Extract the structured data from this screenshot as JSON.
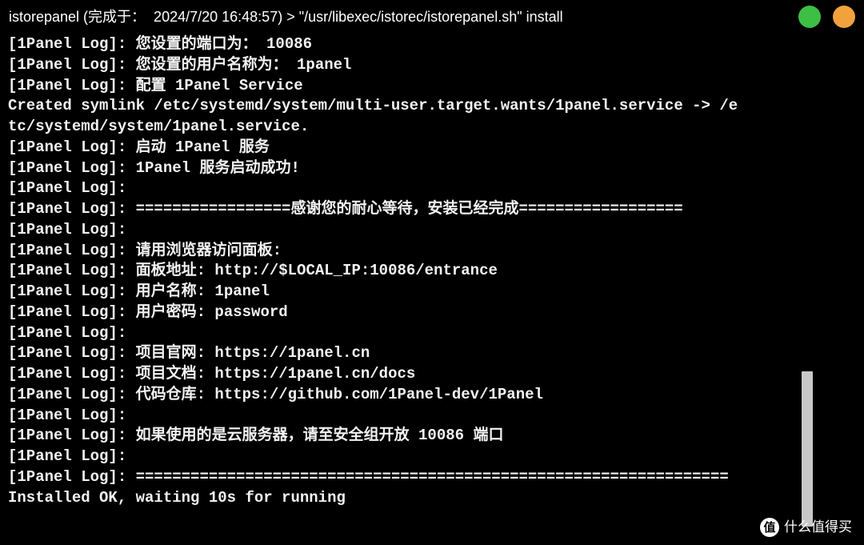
{
  "window": {
    "title": "istorepanel (完成于：  2024/7/20 16:48:57) > \"/usr/libexec/istorec/istorepanel.sh\" install",
    "buttons": {
      "green": "#3dbf45",
      "orange": "#f2a23c"
    }
  },
  "terminal": {
    "text_color": "#f2f2f2",
    "background": "#000000",
    "lines": [
      "[1Panel Log]: 您设置的端口为： 10086",
      "[1Panel Log]: 您设置的用户名称为： 1panel",
      "[1Panel Log]: 配置 1Panel Service",
      "Created symlink /etc/systemd/system/multi-user.target.wants/1panel.service -> /e",
      "tc/systemd/system/1panel.service.",
      "[1Panel Log]: 启动 1Panel 服务",
      "[1Panel Log]: 1Panel 服务启动成功!",
      "[1Panel Log]:",
      "[1Panel Log]: =================感谢您的耐心等待，安装已经完成==================",
      "[1Panel Log]:",
      "[1Panel Log]: 请用浏览器访问面板:",
      "[1Panel Log]: 面板地址: http://$LOCAL_IP:10086/entrance",
      "[1Panel Log]: 用户名称: 1panel",
      "[1Panel Log]: 用户密码: password",
      "[1Panel Log]:",
      "[1Panel Log]: 项目官网: https://1panel.cn",
      "[1Panel Log]: 项目文档: https://1panel.cn/docs",
      "[1Panel Log]: 代码仓库: https://github.com/1Panel-dev/1Panel",
      "[1Panel Log]:",
      "[1Panel Log]: 如果使用的是云服务器，请至安全组开放 10086 端口",
      "[1Panel Log]:",
      "[1Panel Log]: =================================================================",
      "Installed OK, waiting 10s for running"
    ]
  },
  "watermark": {
    "logo": "值",
    "text": "什么值得买"
  }
}
